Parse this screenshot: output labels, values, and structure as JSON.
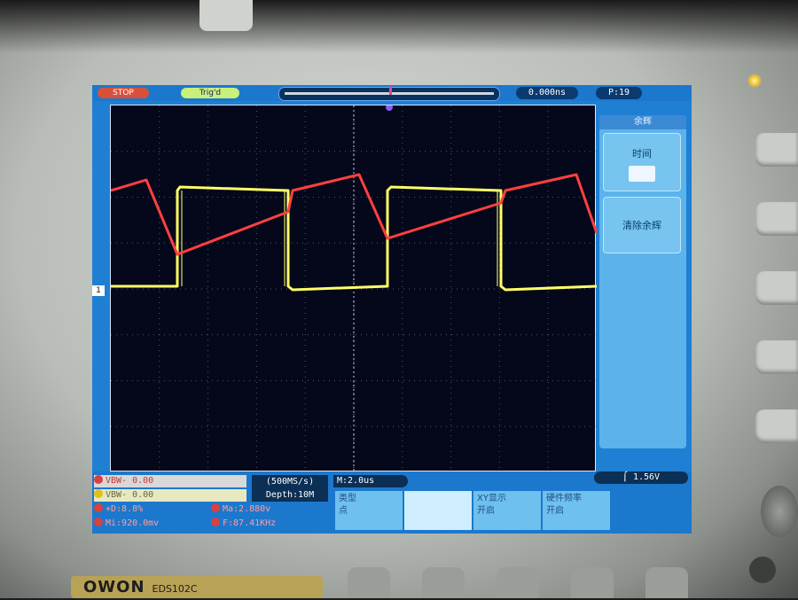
{
  "device": {
    "brand": "OWON",
    "model": "EDS102C"
  },
  "topbar": {
    "status": "STOP",
    "trigger_status": "Trig'd",
    "time_offset": "0.000ns",
    "trigger_position": "P:19"
  },
  "right_menu": {
    "title": "余辉",
    "items": [
      {
        "label": "时间"
      },
      {
        "label": "清除余辉"
      }
    ]
  },
  "measurements": {
    "row1": "VBW-      0.00",
    "row2": "VBW-      0.00",
    "row3": "+D:8.8%",
    "row3b": "Ma:2.880v",
    "row4": "Mi:920.0mv",
    "row4b": "F:87.41KHz"
  },
  "acquisition": {
    "sample_rate": "(500MS/s)",
    "depth": "Depth:10M"
  },
  "timebase": "M:2.0us",
  "trigger_level": "1.56V",
  "softkeys": [
    {
      "label": "类型",
      "sub": "点"
    },
    {
      "label": "",
      "sub": ""
    },
    {
      "label": "XY显示",
      "sub": "开启"
    },
    {
      "label": "硬件频率",
      "sub": "开启"
    }
  ],
  "channel_marker": "1",
  "colors": {
    "ch1": "#ffff66",
    "ch2": "#ff4040",
    "screen_bg": "#1f7fd3",
    "grid_bg": "#05081a"
  }
}
